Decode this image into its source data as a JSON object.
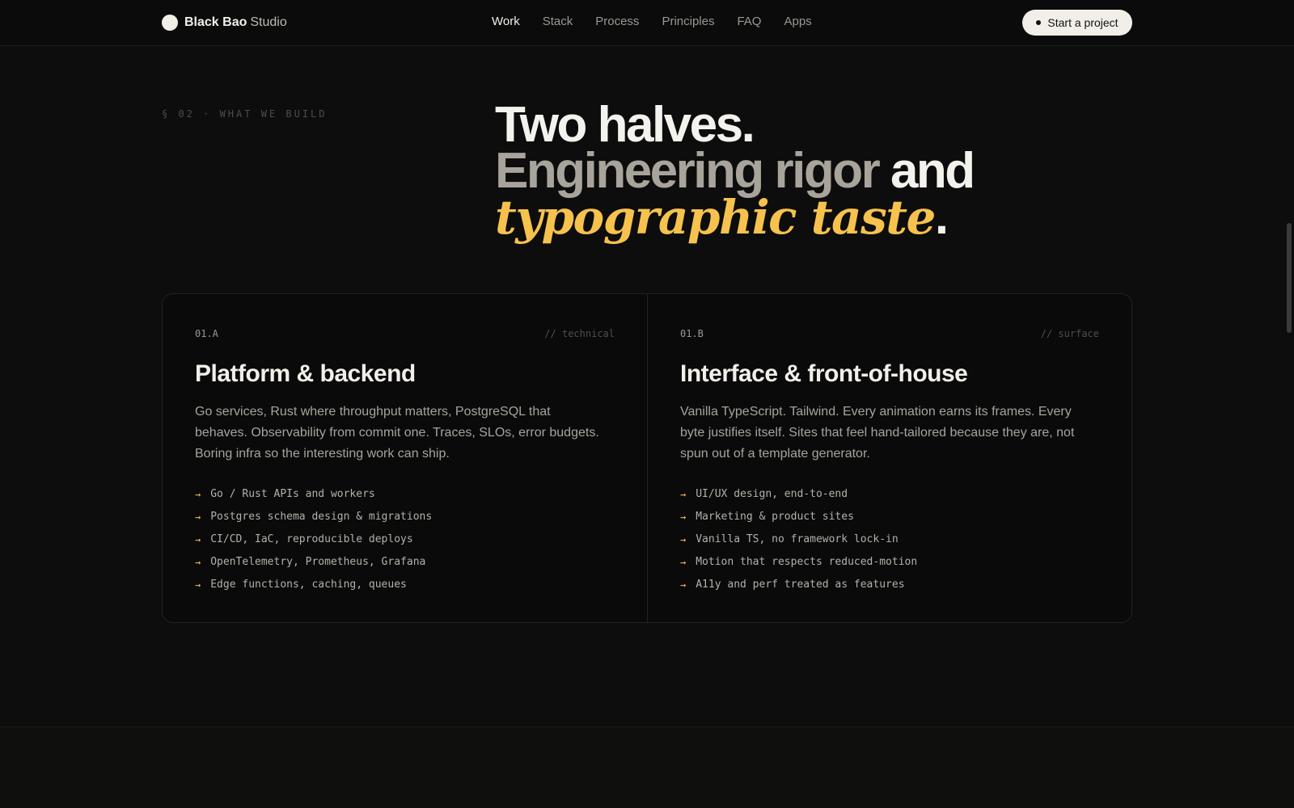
{
  "header": {
    "brand_name": "Black Bao",
    "brand_suffix": "Studio",
    "nav": [
      "Work",
      "Stack",
      "Process",
      "Principles",
      "FAQ",
      "Apps"
    ],
    "active_nav": "Work",
    "cta_label": "Start a project"
  },
  "section": {
    "eyebrow": "§ 02 · WHAT WE BUILD",
    "headline": {
      "line1": "Two halves.",
      "line2_muted": "Engineering rigor",
      "line2_bright": "and",
      "line3_accent": "typographic taste",
      "line3_end": "."
    }
  },
  "cards": [
    {
      "code": "01.A",
      "tag": "// technical",
      "title": "Platform & backend",
      "description": "Go services, Rust where throughput matters, PostgreSQL that behaves. Observability from commit one. Traces, SLOs, error budgets. Boring infra so the interesting work can ship.",
      "items": [
        "Go / Rust APIs and workers",
        "Postgres schema design & migrations",
        "CI/CD, IaC, reproducible deploys",
        "OpenTelemetry, Prometheus, Grafana",
        "Edge functions, caching, queues"
      ]
    },
    {
      "code": "01.B",
      "tag": "// surface",
      "title": "Interface & front-of-house",
      "description": "Vanilla TypeScript. Tailwind. Every animation earns its frames. Every byte justifies itself. Sites that feel hand-tailored because they are, not spun out of a template generator.",
      "items": [
        "UI/UX design, end-to-end",
        "Marketing & product sites",
        "Vanilla TS, no framework lock-in",
        "Motion that respects reduced-motion",
        "A11y and perf treated as features"
      ]
    }
  ],
  "list_marker": "→",
  "colors": {
    "background": "#0d0d0d",
    "accent": "#f6c24e",
    "text": "#f1efe8",
    "muted_text": "#a6a49c"
  },
  "icons": {
    "brand_logo": "filled-circle-logo",
    "cta_indicator": "dot-icon",
    "list_marker": "arrow-right-icon"
  }
}
